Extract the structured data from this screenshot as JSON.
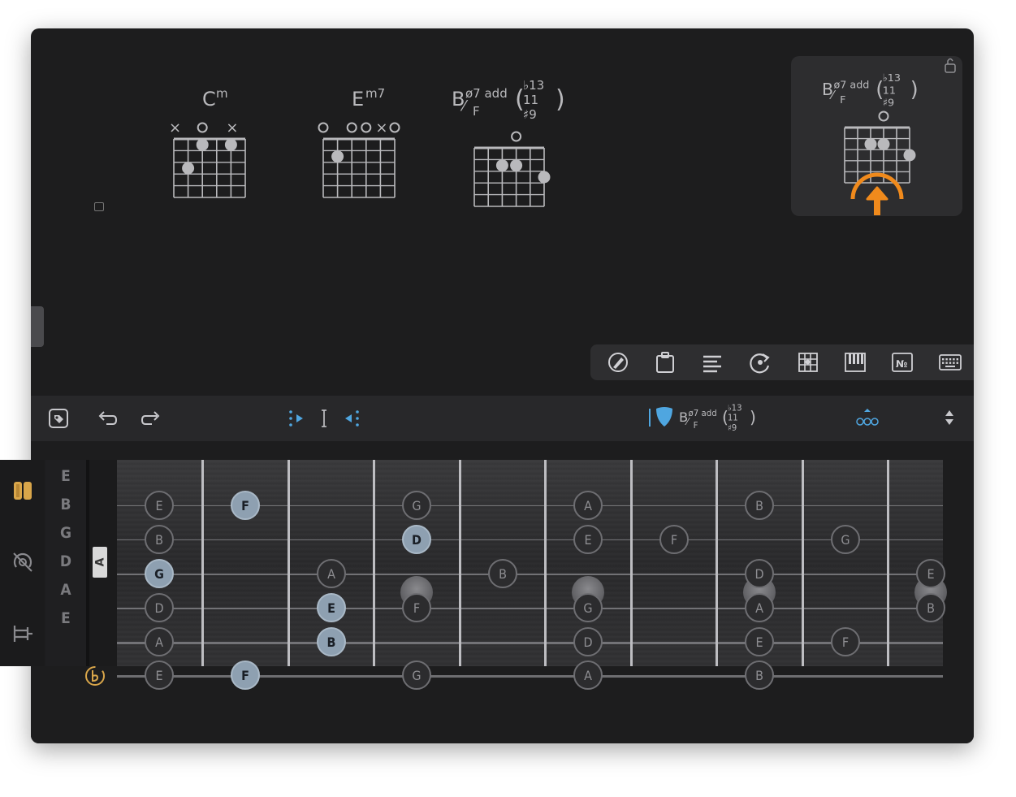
{
  "chords": [
    {
      "root": "C",
      "sup": "m",
      "markers": [
        "x",
        "",
        "o",
        "",
        "x",
        ""
      ],
      "dots": [
        [
          2,
          1
        ],
        [
          4,
          1
        ],
        [
          1,
          3
        ]
      ]
    },
    {
      "root": "E",
      "sup": "m7",
      "markers": [
        "o",
        "",
        "o",
        "o",
        "x",
        "o"
      ],
      "dots": [
        [
          1,
          2
        ]
      ]
    },
    {
      "root": "B",
      "sup": "ø7 add",
      "bass": "F",
      "stack": [
        "♭13",
        "11",
        "♯9"
      ],
      "markers": [
        "",
        "",
        "",
        "o",
        "",
        ""
      ],
      "dots": [
        [
          2,
          2
        ],
        [
          3,
          2
        ],
        [
          5,
          3
        ]
      ]
    }
  ],
  "current_card": {
    "root": "B",
    "sup": "ø7 add",
    "bass": "F",
    "stack": [
      "♭13",
      "11",
      "♯9"
    ],
    "lock_icon": "unlocked-padlock-icon",
    "overlay_icon": "swipe-up-arrow-icon",
    "accent": "#f08a1c"
  },
  "tools": [
    "pencil-pick-icon",
    "clipboard-icon",
    "lines-icon",
    "rotate-chord-icon",
    "fretboard-icon",
    "piano-icon",
    "number-icon",
    "keyboard-icon"
  ],
  "toolbar": {
    "tag_icon": "tag-icon",
    "undo_icon": "undo-icon",
    "redo_icon": "redo-icon",
    "loop_start_icon": "loop-start-icon",
    "cursor_icon": "text-cursor-icon",
    "loop_end_icon": "loop-end-icon",
    "pick_icon": "guitar-pick-icon",
    "chord": {
      "root": "B",
      "sup": "ø7 add",
      "bass": "F",
      "stack": [
        "♭13",
        "11",
        "♯9"
      ]
    },
    "voicings_icon": "voicings-icon",
    "stepper_icon": "up-down-stepper-icon",
    "accent": "#4fa6e0"
  },
  "side_icons": [
    "guitar-body-icon",
    "tuner-icon",
    "fret-range-icon",
    "flat-toggle-icon"
  ],
  "strings": [
    "E",
    "B",
    "G",
    "D",
    "A",
    "E"
  ],
  "capo_label": "A",
  "notes": [
    {
      "s": 0,
      "f": 0,
      "n": "E"
    },
    {
      "s": 0,
      "f": 1,
      "n": "F",
      "a": true
    },
    {
      "s": 0,
      "f": 3,
      "n": "G"
    },
    {
      "s": 0,
      "f": 5,
      "n": "A"
    },
    {
      "s": 0,
      "f": 7,
      "n": "B"
    },
    {
      "s": 1,
      "f": 0,
      "n": "B"
    },
    {
      "s": 1,
      "f": 3,
      "n": "D",
      "a": true
    },
    {
      "s": 1,
      "f": 5,
      "n": "E"
    },
    {
      "s": 1,
      "f": 6,
      "n": "F"
    },
    {
      "s": 1,
      "f": 8,
      "n": "G"
    },
    {
      "s": 2,
      "f": 0,
      "n": "G",
      "a": true
    },
    {
      "s": 2,
      "f": 2,
      "n": "A"
    },
    {
      "s": 2,
      "f": 4,
      "n": "B"
    },
    {
      "s": 2,
      "f": 7,
      "n": "D"
    },
    {
      "s": 2,
      "f": 9,
      "n": "E"
    },
    {
      "s": 3,
      "f": 0,
      "n": "D"
    },
    {
      "s": 3,
      "f": 2,
      "n": "E",
      "a": true
    },
    {
      "s": 3,
      "f": 3,
      "n": "F"
    },
    {
      "s": 3,
      "f": 5,
      "n": "G"
    },
    {
      "s": 3,
      "f": 7,
      "n": "A"
    },
    {
      "s": 3,
      "f": 9,
      "n": "B"
    },
    {
      "s": 4,
      "f": 0,
      "n": "A"
    },
    {
      "s": 4,
      "f": 2,
      "n": "B",
      "a": true
    },
    {
      "s": 4,
      "f": 5,
      "n": "D"
    },
    {
      "s": 4,
      "f": 7,
      "n": "E"
    },
    {
      "s": 4,
      "f": 8,
      "n": "F"
    },
    {
      "s": 5,
      "f": 0,
      "n": "E"
    },
    {
      "s": 5,
      "f": 1,
      "n": "F",
      "a": true
    },
    {
      "s": 5,
      "f": 3,
      "n": "G"
    },
    {
      "s": 5,
      "f": 5,
      "n": "A"
    },
    {
      "s": 5,
      "f": 7,
      "n": "B"
    }
  ],
  "ghosts": [
    {
      "f": 3,
      "between": [
        2,
        3
      ]
    },
    {
      "f": 5,
      "between": [
        2,
        3
      ]
    },
    {
      "f": 7,
      "between": [
        2,
        3
      ]
    },
    {
      "f": 9,
      "between": [
        2,
        3
      ]
    }
  ]
}
